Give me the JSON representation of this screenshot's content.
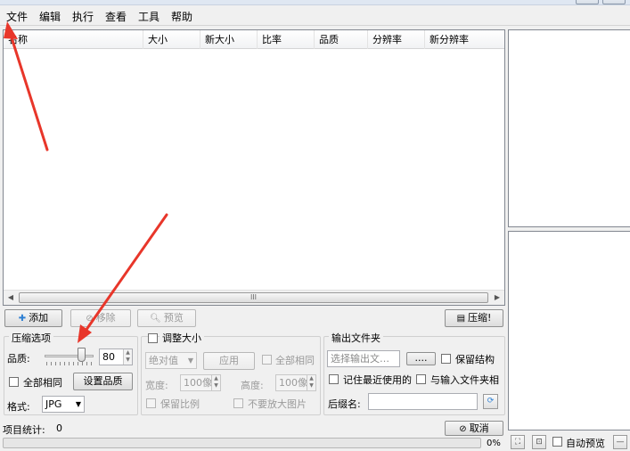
{
  "menu": {
    "file": "文件",
    "edit": "编辑",
    "run": "执行",
    "view": "查看",
    "tools": "工具",
    "help": "帮助"
  },
  "list": {
    "columns": [
      "名称",
      "大小",
      "新大小",
      "比率",
      "品质",
      "分辨率",
      "新分辨率"
    ],
    "scroll_grip": "III"
  },
  "toolbar": {
    "add": "添加",
    "remove": "移除",
    "preview": "预览",
    "compress": "压缩!"
  },
  "compress_options": {
    "title": "压缩选项",
    "quality_label": "品质:",
    "quality_value": "80",
    "quality_percent": 80,
    "all_same_label": "全部相同",
    "set_quality_button": "设置品质",
    "format_label": "格式:",
    "format_value": "JPG"
  },
  "resize": {
    "title": "调整大小",
    "mode_value": "绝对值",
    "apply_button": "应用",
    "all_same_label": "全部相同",
    "width_label": "宽度:",
    "width_value": "100像",
    "height_label": "高度:",
    "height_value": "100像",
    "keep_ratio_label": "保留比例",
    "no_enlarge_label": "不要放大图片"
  },
  "output": {
    "title": "输出文件夹",
    "folder_placeholder": "选择输出文…",
    "browse_button": "....",
    "keep_structure_label": "保留结构",
    "remember_recent_label": "记住最近使用的",
    "same_as_input_label": "与输入文件夹相",
    "suffix_label": "后缀名:",
    "suffix_value": ""
  },
  "status": {
    "item_count_label": "项目统计:",
    "item_count": "0",
    "cancel_button": "取消",
    "progress_text": "0%",
    "progress_percent": 0,
    "auto_preview_label": "自动预览"
  },
  "colors": {
    "annotation_arrow": "#e8362a",
    "window_bg": "#f0f0f0",
    "progress_fill": "#37b34a"
  }
}
